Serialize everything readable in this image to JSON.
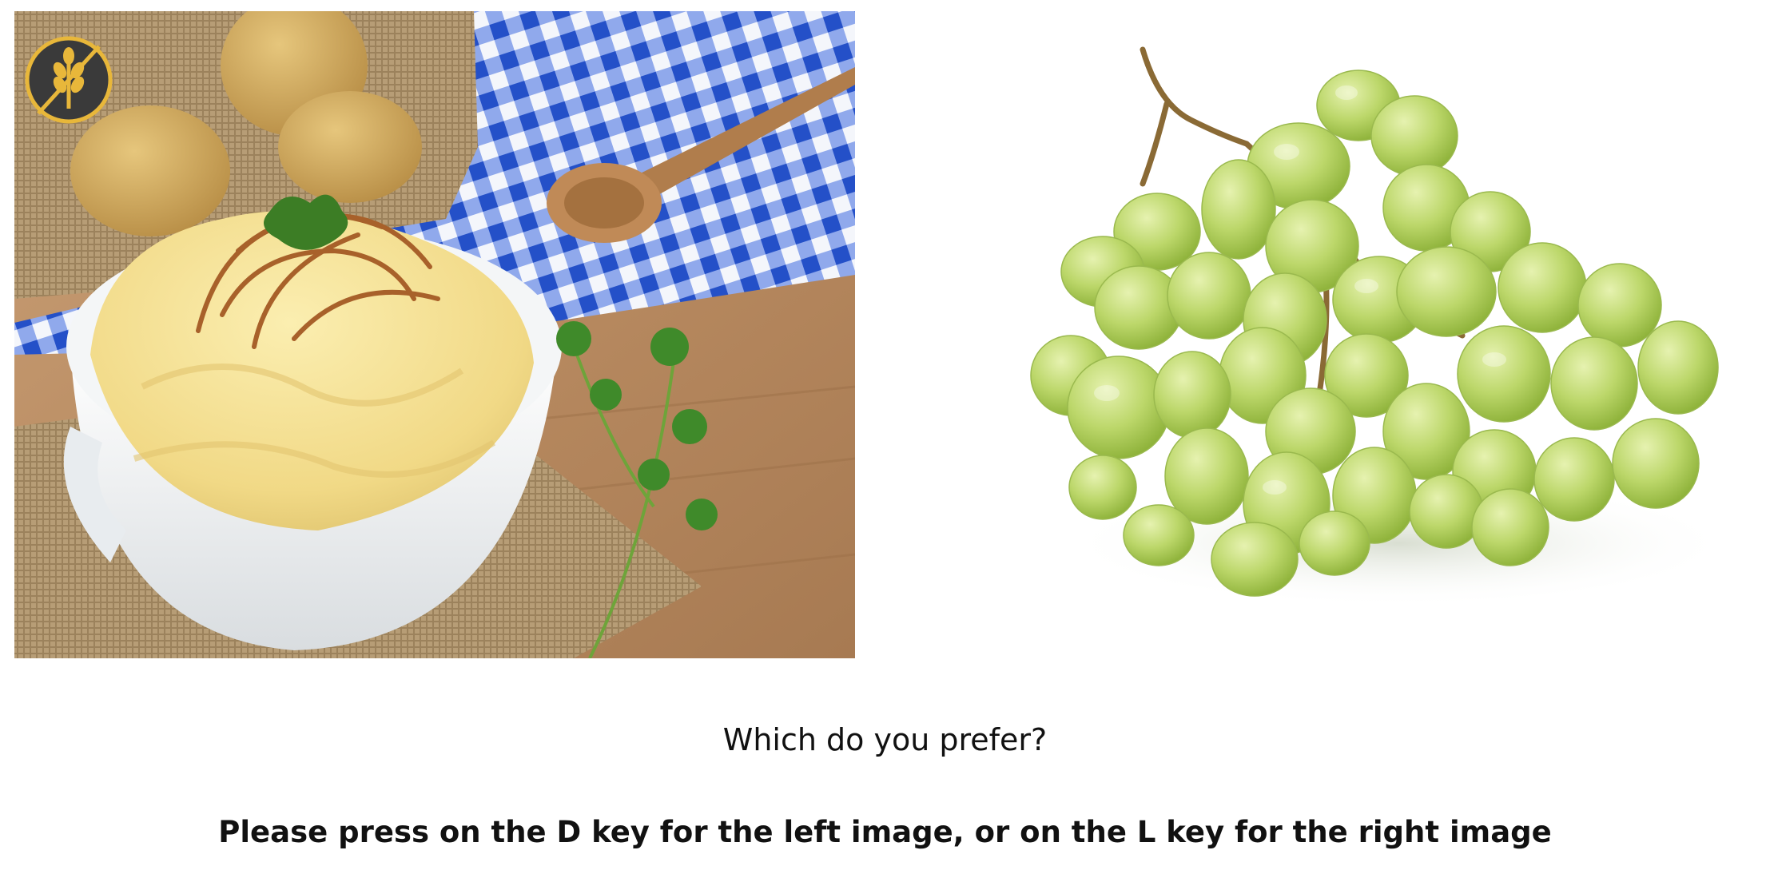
{
  "trial": {
    "left_image": {
      "subject": "mashed potatoes",
      "badge_icon": "wheat-icon"
    },
    "right_image": {
      "subject": "green grapes"
    },
    "question": "Which do you prefer?",
    "instruction": "Please press on the D key for the left image, or on the L key for the right image"
  },
  "colors": {
    "background": "#ffffff",
    "text": "#111111",
    "badge_fill": "#3a3a3a",
    "badge_accent": "#e8b73a",
    "check_blue": "#2f64d6",
    "mash_yellow": "#f3dc8c",
    "grape_green": "#b9d66a"
  }
}
